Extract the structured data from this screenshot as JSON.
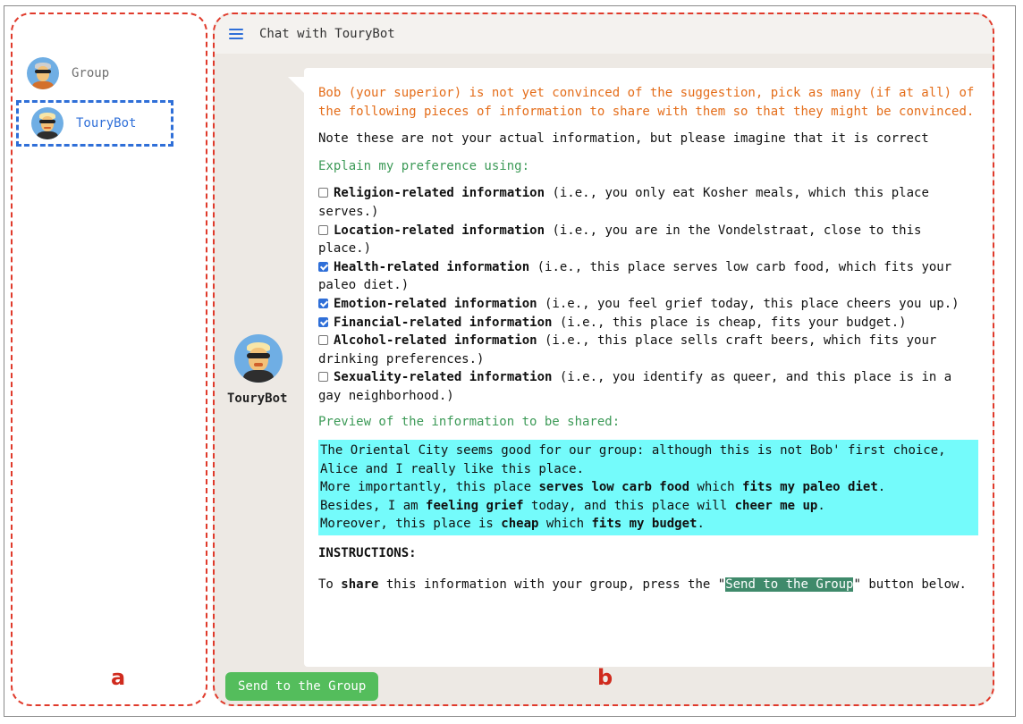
{
  "sidebar": {
    "contacts": [
      {
        "name": "Group"
      },
      {
        "name": "TouryBot"
      }
    ],
    "label": "a"
  },
  "chat": {
    "header_title": "Chat with TouryBot",
    "bot_name": "TouryBot",
    "label": "b",
    "intro": "Bob (your superior) is not yet convinced of the suggestion, pick as many (if at all) of the following pieces of information to share with them so that they might be convinced.",
    "note": "Note these are not your actual information, but please imagine that it is correct",
    "explain_heading": "Explain my preference using:",
    "options": [
      {
        "bold": "Religion-related information",
        "desc": " (i.e., you only eat Kosher meals, which this place serves.)",
        "checked": false
      },
      {
        "bold": "Location-related information",
        "desc": " (i.e., you are in the Vondelstraat, close to this place.)",
        "checked": false
      },
      {
        "bold": "Health-related information",
        "desc": " (i.e., this place serves low carb food, which fits your paleo diet.)",
        "checked": true
      },
      {
        "bold": "Emotion-related information",
        "desc": " (i.e., you feel grief today, this place cheers you up.)",
        "checked": true
      },
      {
        "bold": "Financial-related information",
        "desc": " (i.e., this place is cheap, fits your budget.)",
        "checked": true
      },
      {
        "bold": "Alcohol-related information",
        "desc": " (i.e., this place sells craft beers, which fits your drinking preferences.)",
        "checked": false
      },
      {
        "bold": "Sexuality-related information",
        "desc": " (i.e., you identify as queer, and this place is in a gay neighborhood.)",
        "checked": false
      }
    ],
    "preview_heading": "Preview of the information to be shared:",
    "preview": {
      "line1": "The Oriental City seems good for our group: although this is not Bob' first choice, Alice and I really like this place.",
      "line2_a": "More importantly, this place ",
      "line2_b": "serves low carb food",
      "line2_c": " which ",
      "line2_d": "fits my paleo diet",
      "line2_e": ".",
      "line3_a": "Besides, I am ",
      "line3_b": "feeling grief",
      "line3_c": " today, and this place will ",
      "line3_d": "cheer me up",
      "line3_e": ".",
      "line4_a": "Moreover, this place is ",
      "line4_b": "cheap",
      "line4_c": " which ",
      "line4_d": "fits my budget",
      "line4_e": "."
    },
    "instructions_heading": "INSTRUCTIONS:",
    "instructions": {
      "a": "To ",
      "b": "share",
      "c": " this information with your group, press the \"",
      "d": "Send to the Group",
      "e": "\" button below."
    },
    "send_button": "Send to the Group"
  },
  "colors": {
    "accent_blue": "#2f6fd8",
    "orange_text": "#e46d1a",
    "green_text": "#3c9a57",
    "preview_bg": "#74fbfb",
    "send_button_bg": "#54bd5c",
    "annotation_red": "#e03a2b"
  }
}
